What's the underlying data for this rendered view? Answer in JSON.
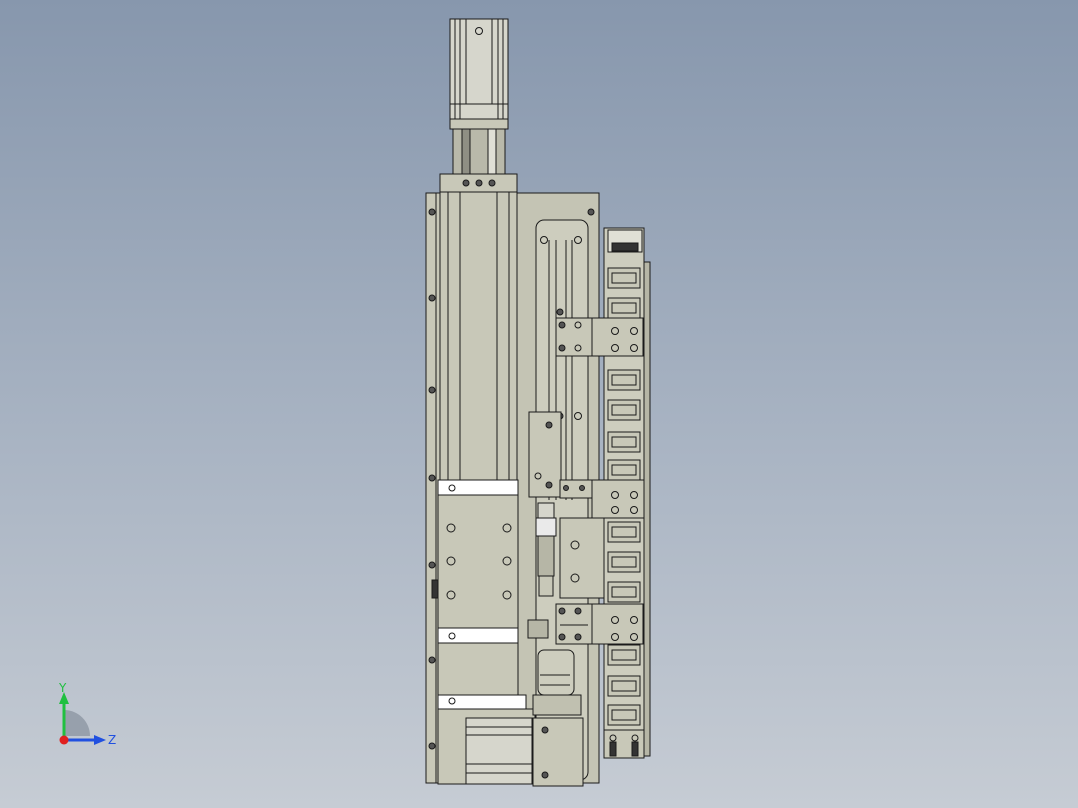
{
  "viewport": {
    "background_top": "#8797ad",
    "background_bottom": "#c6ccd4"
  },
  "model": {
    "part_fill": "#c8c8b8",
    "part_fill_dark": "#b6b6a6",
    "edge_color": "#1a1a1a",
    "highlight": "#ffffff",
    "motor_fill": "#d6d6cc",
    "cable_chain_links": 16
  },
  "triad": {
    "y_label": "Y",
    "z_label": "Z",
    "y_color": "#20c040",
    "z_color": "#2050e0",
    "x_color": "#e02020"
  }
}
